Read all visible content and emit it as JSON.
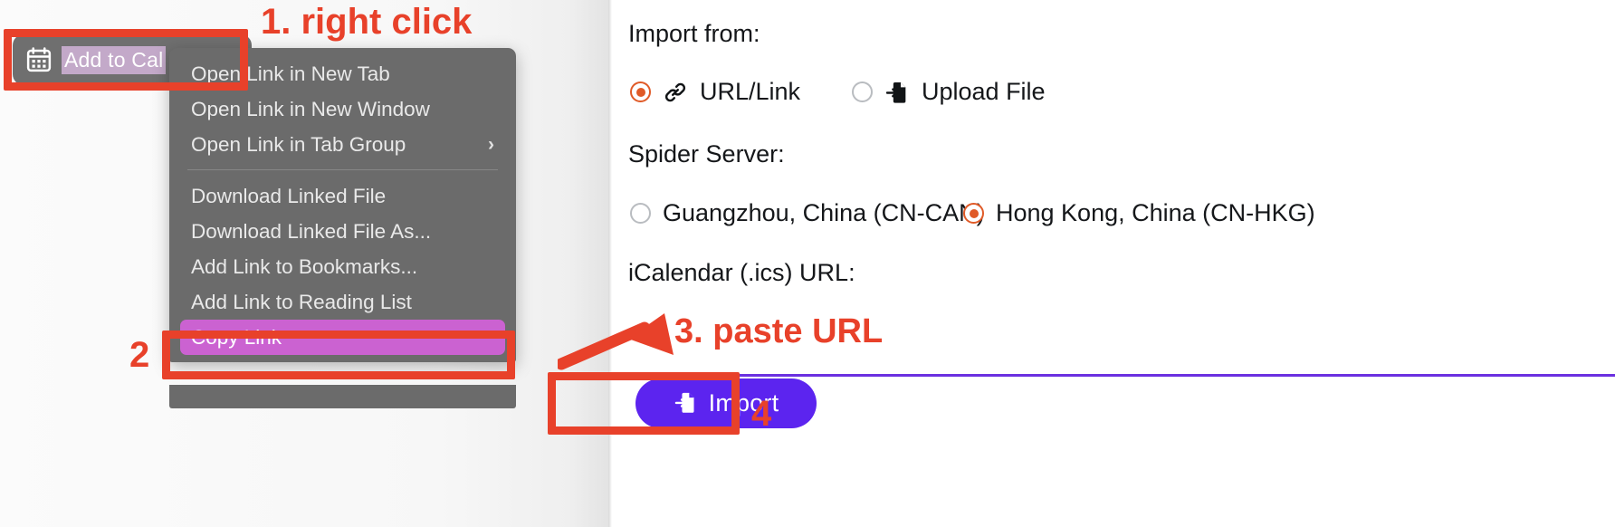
{
  "left": {
    "add_to_calendar_button": {
      "label": "Add to Cal",
      "icon": "calendar-icon"
    },
    "context_menu": {
      "groups": [
        {
          "items": [
            {
              "label": "Open Link in New Tab",
              "submenu": false
            },
            {
              "label": "Open Link in New Window",
              "submenu": false
            },
            {
              "label": "Open Link in Tab Group",
              "submenu": true,
              "submenu_icon": "chevron-right-icon"
            }
          ]
        },
        {
          "items": [
            {
              "label": "Download Linked File",
              "submenu": false
            },
            {
              "label": "Download Linked File As...",
              "submenu": false
            },
            {
              "label": "Add Link to Bookmarks...",
              "submenu": false
            },
            {
              "label": "Add Link to Reading List",
              "submenu": false
            },
            {
              "label": "Copy Link",
              "submenu": false,
              "highlighted": true
            }
          ]
        }
      ]
    }
  },
  "right": {
    "import_from": {
      "label": "Import from:",
      "options": [
        {
          "label": "URL/Link",
          "icon": "link-chain-icon",
          "selected": true
        },
        {
          "label": "Upload File",
          "icon": "file-import-icon",
          "selected": false
        }
      ]
    },
    "spider_server": {
      "label": "Spider Server:",
      "options": [
        {
          "label": "Guangzhou, China (CN-CAN)",
          "selected": false
        },
        {
          "label": "Hong Kong, China (CN-HKG)",
          "selected": true
        }
      ]
    },
    "ics_url": {
      "label": "iCalendar (.ics) URL:",
      "value": "",
      "placeholder": ""
    },
    "import_button": {
      "label": "Import",
      "icon": "file-import-icon"
    }
  },
  "annotations": {
    "step1": "1. right click",
    "step2": "2",
    "step3": "3. paste URL",
    "step4": "4"
  },
  "colors": {
    "annotation_red": "#e8412a",
    "menu_gray": "#6b6b6b",
    "highlight_magenta": "#cb62d1",
    "radio_orange": "#e05a27",
    "input_underline_purple": "#6b30e0",
    "import_button_purple": "#5c24ef",
    "selection_lavender": "#c3a9c9"
  }
}
